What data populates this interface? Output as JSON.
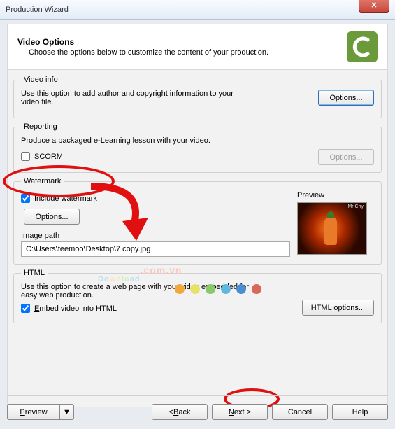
{
  "window": {
    "title": "Production Wizard",
    "close": "✕"
  },
  "header": {
    "title": "Video Options",
    "subtitle": "Choose the options below to customize the content of your production."
  },
  "video_info": {
    "legend": "Video info",
    "desc": "Use this option to add author and copyright information to your video file.",
    "options_btn": "Options..."
  },
  "reporting": {
    "legend": "Reporting",
    "desc": "Produce a packaged e-Learning lesson with your video.",
    "scorm_label": "SCORM",
    "scorm_checked": false,
    "options_btn": "Options..."
  },
  "watermark": {
    "legend": "Watermark",
    "include_label": "Include watermark",
    "include_checked": true,
    "options_btn": "Options...",
    "image_path_label": "Image path",
    "image_path_value": "C:\\Users\\teemoo\\Desktop\\7 copy.jpg",
    "preview_label": "Preview",
    "preview_badge": "Mr Chy"
  },
  "html": {
    "legend": "HTML",
    "desc": "Use this option to create a web page with your video embedded for easy web production.",
    "embed_label": "Embed video into HTML",
    "embed_checked": true,
    "html_options_btn": "HTML options..."
  },
  "footer": {
    "preview": "Preview",
    "dropdown": "▼",
    "back": "< Back",
    "next": "Next >",
    "cancel": "Cancel",
    "help": "Help"
  },
  "overlay": {
    "brand": "Download",
    "tld": ".com",
    "cc": ".vn",
    "dots": [
      "#f2a83a",
      "#e7e26a",
      "#8ac96b",
      "#5fb8e0",
      "#4a8dd0",
      "#d66a5a"
    ]
  }
}
